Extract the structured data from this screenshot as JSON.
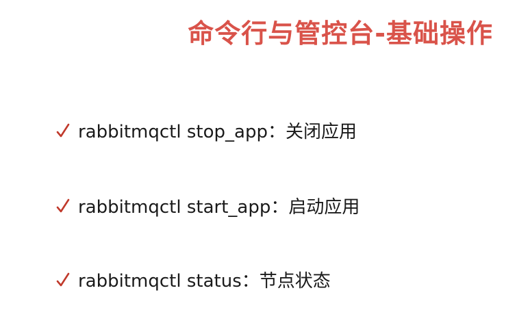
{
  "slide": {
    "title": "命令行与管控台-基础操作",
    "accent_color": "#d9534a",
    "bullet_icon": "check-icon",
    "items": [
      {
        "text": "rabbitmqctl stop_app：关闭应用"
      },
      {
        "text": "rabbitmqctl start_app：启动应用"
      },
      {
        "text": "rabbitmqctl status：节点状态"
      }
    ]
  }
}
